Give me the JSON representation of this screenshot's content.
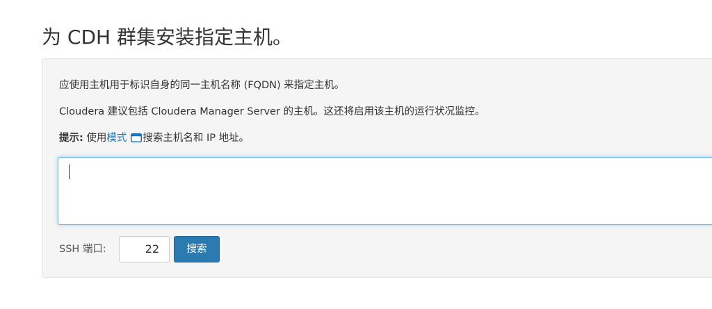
{
  "page": {
    "title": "为 CDH 群集安装指定主机。"
  },
  "panel": {
    "intro": "应使用主机用于标识自身的同一主机名称 (FQDN) 来指定主机。",
    "recommend": "Cloudera 建议包括 Cloudera Manager Server 的主机。这还将启用该主机的运行状况监控。",
    "hint": {
      "label": "提示:",
      "prefix": " 使用",
      "link": "模式",
      "suffix": "搜索主机名和 IP 地址。",
      "icon": "window-icon"
    },
    "hosts_textarea": {
      "value": "",
      "placeholder": ""
    },
    "ssh_port": {
      "label": "SSH 端口:",
      "value": "22"
    },
    "search_button": "搜索"
  },
  "colors": {
    "link": "#1f74b5",
    "primary_button": "#2b7bb0",
    "panel_bg": "#f5f5f5",
    "focus_border": "#66afe9"
  }
}
